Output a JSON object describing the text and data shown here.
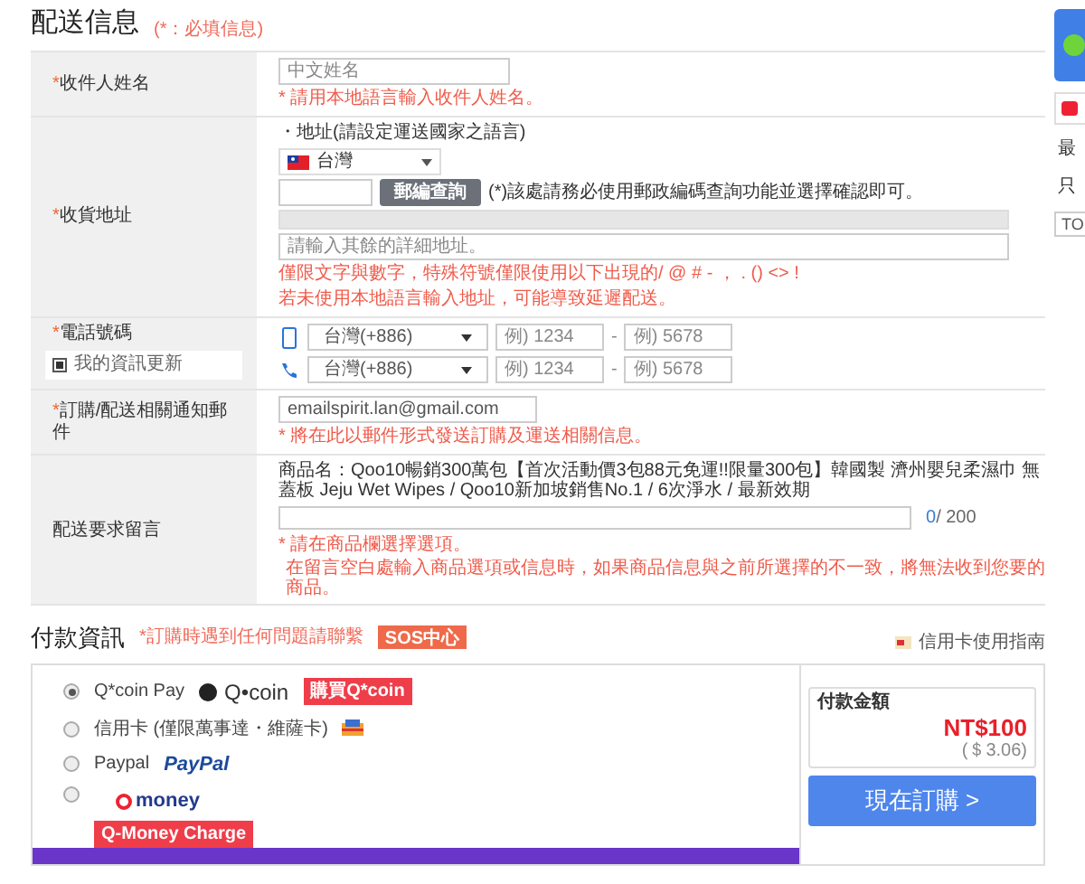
{
  "shipping": {
    "title": "配送信息",
    "required_note": "(*：必填信息)",
    "name_row": {
      "mark": "*",
      "label": "收件人姓名",
      "placeholder": "中文姓名",
      "hint": "* 請用本地語言輸入收件人姓名。"
    },
    "address_row": {
      "mark": "*",
      "label": "收貨地址",
      "address_note": "・地址(請設定運送國家之語言)",
      "country": "台灣",
      "zip_button": "郵編查詢",
      "zip_note": "(*)該處請務必使用郵政編碼查詢功能並選擇確認即可。",
      "detail_placeholder": "請輸入其餘的詳細地址。",
      "warnings": [
        "僅限文字與數字，特殊符號僅限使用以下出現的/ @ # - ， . () <> !",
        "若未使用本地語言輸入地址，可能導致延遲配送。"
      ]
    },
    "phone_row": {
      "mark": "*",
      "label": "電話號碼",
      "update_label": "我的資訊更新",
      "update_checked": true,
      "phones": [
        {
          "kind": "mobile",
          "country": "台灣(+886)",
          "part1": {
            "placeholder": "例) 1234"
          },
          "separator": "-",
          "part2": {
            "placeholder": "例) 5678"
          }
        },
        {
          "kind": "landline",
          "country": "台灣(+886)",
          "part1": {
            "placeholder": "例) 1234"
          },
          "separator": "-",
          "part2": {
            "placeholder": "例) 5678"
          }
        }
      ]
    },
    "email_row": {
      "mark": "*",
      "label": "訂購/配送相關通知郵件",
      "value": "emailspirit.lan@gmail.com",
      "hint": "* 將在此以郵件形式發送訂購及運送相關信息。"
    },
    "message_row": {
      "label": "配送要求留言",
      "product": "商品名：Qoo10暢銷300萬包【首次活動價3包88元免運!!限量300包】韓國製 濟州嬰兒柔濕巾 無蓋板 Jeju Wet Wipes / Qoo10新加坡銷售No.1 / 6次淨水 / 最新效期",
      "counter_used": "0",
      "counter_max": "/ 200",
      "hints": [
        "* 請在商品欄選擇選項。",
        "在留言空白處輸入商品選項或信息時，如果商品信息與之前所選擇的不一致，將無法收到您要的商品。"
      ]
    }
  },
  "payment": {
    "title": "付款資訊",
    "help_note": "*訂購時遇到任何問題請聯繫",
    "sos_button": "SOS中心",
    "guide_link": "信用卡使用指南",
    "methods": [
      {
        "kind": "qcoin",
        "label": "Q*coin Pay",
        "logo_text": "Q•coin",
        "action": "購買Q*coin",
        "selected": true
      },
      {
        "kind": "card",
        "label": "信用卡 (僅限萬事達・維薩卡)",
        "selected": false
      },
      {
        "kind": "paypal",
        "label": "Paypal",
        "logo_text": "PayPal",
        "selected": false
      },
      {
        "kind": "qmoney",
        "logo_text": "money",
        "action": "Q-Money Charge",
        "selected": false
      }
    ],
    "amount_label": "付款金額",
    "amount": "NT$100",
    "amount_sub": "(＄3.06)",
    "order_button": "現在訂購 >"
  },
  "side_strip": {
    "texts": [
      "最",
      "只"
    ],
    "top_button": "TO"
  }
}
